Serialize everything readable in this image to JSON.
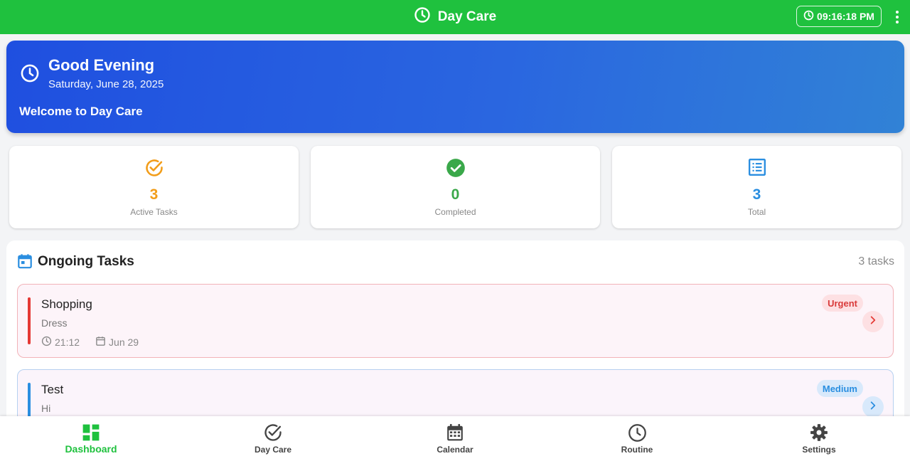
{
  "app": {
    "title": "Day Care",
    "clock": "09:16:18 PM"
  },
  "hero": {
    "greeting": "Good Evening",
    "date": "Saturday, June 28, 2025",
    "welcome": "Welcome to Day Care",
    "gradient_from": "#1f4fe0",
    "gradient_to": "#3182d6"
  },
  "stats": [
    {
      "value": "3",
      "label": "Active Tasks",
      "icon": "check-circle-outline-icon",
      "color": "#f29d1a"
    },
    {
      "value": "0",
      "label": "Completed",
      "icon": "check-circle-filled-icon",
      "color": "#3aa84a"
    },
    {
      "value": "3",
      "label": "Total",
      "icon": "list-icon",
      "color": "#2a8ee0"
    }
  ],
  "tasks": {
    "title": "Ongoing Tasks",
    "count_label": "3 tasks",
    "items": [
      {
        "title": "Shopping",
        "description": "Dress",
        "time": "21:12",
        "date": "Jun 29",
        "priority": "Urgent",
        "accent": "#e53935"
      },
      {
        "title": "Test",
        "description": "Hi",
        "time": "",
        "date": "",
        "priority": "Medium",
        "accent": "#2a8ee0"
      }
    ]
  },
  "nav": {
    "items": [
      {
        "label": "Dashboard",
        "icon": "dashboard-icon",
        "active": true
      },
      {
        "label": "Day Care",
        "icon": "check-circle-icon",
        "active": false
      },
      {
        "label": "Calendar",
        "icon": "calendar-icon",
        "active": false
      },
      {
        "label": "Routine",
        "icon": "clock-icon",
        "active": false
      },
      {
        "label": "Settings",
        "icon": "gear-icon",
        "active": false
      }
    ]
  },
  "colors": {
    "brand_green": "#1fc13e",
    "urgent": "#d93a3a",
    "medium": "#2a8ee0"
  }
}
